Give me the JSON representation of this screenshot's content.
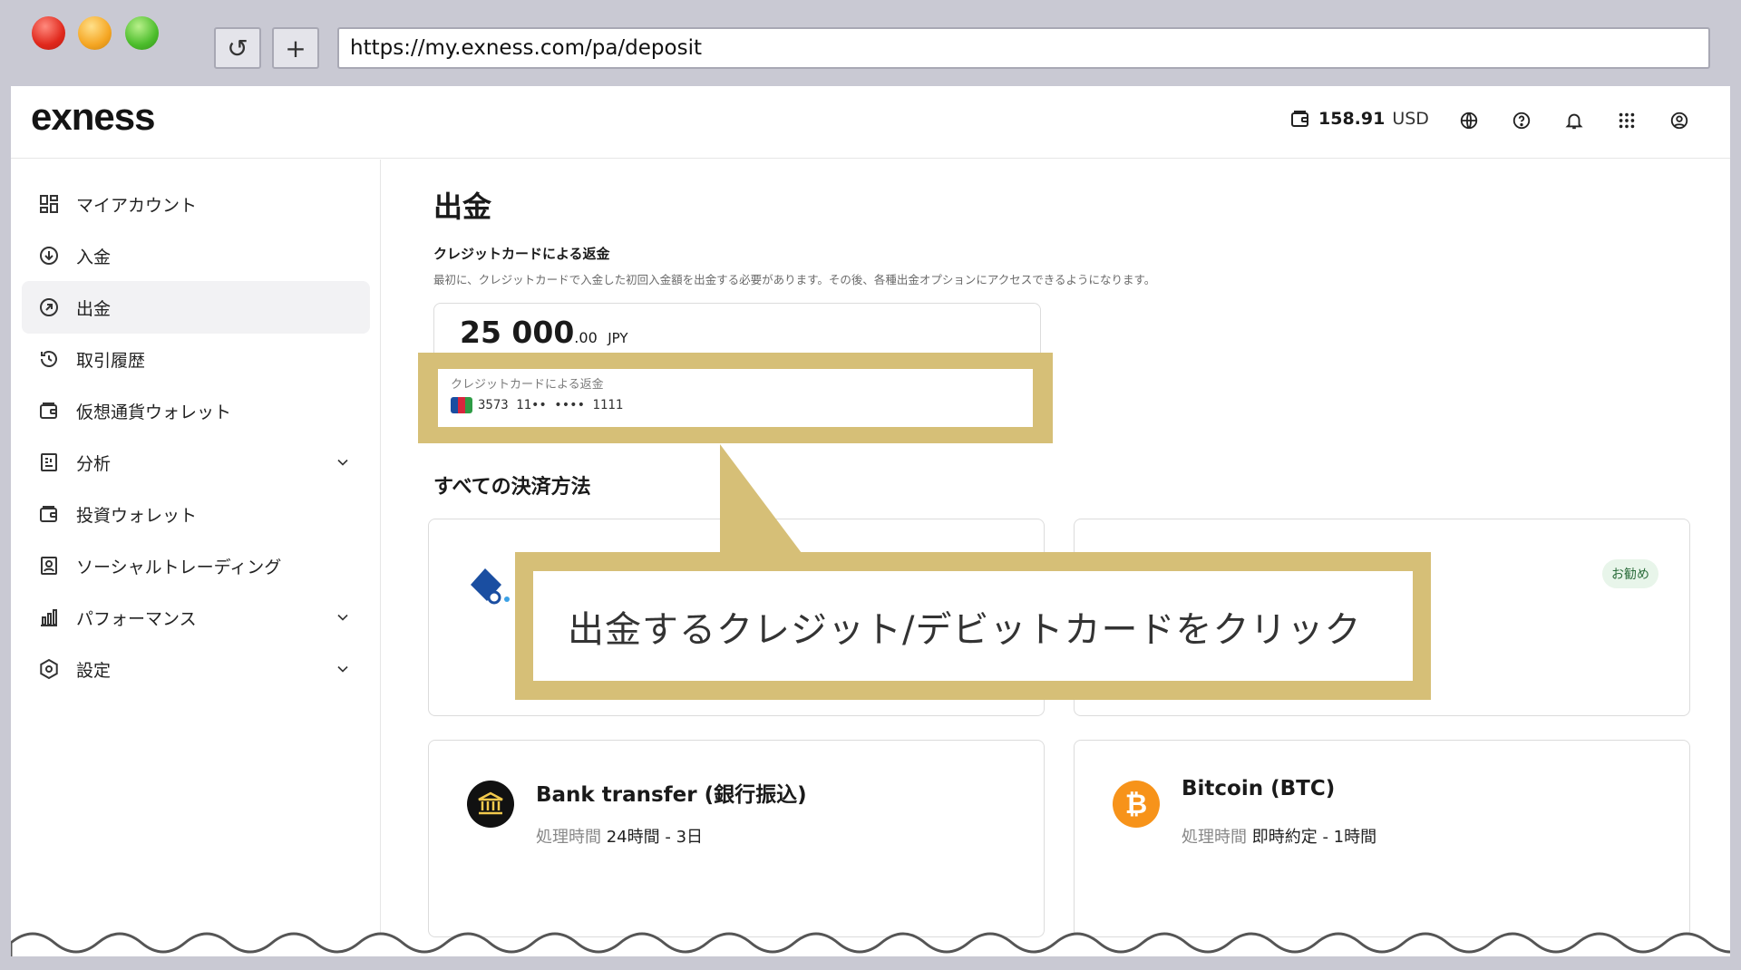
{
  "browser": {
    "url": "https://my.exness.com/pa/deposit",
    "reload_icon": "↺",
    "new_tab_icon": "+"
  },
  "header": {
    "logo": "exness",
    "balance_amount": "158.91",
    "balance_currency": "USD"
  },
  "sidebar": {
    "items": [
      {
        "label": "マイアカウント",
        "icon": "dashboard-icon"
      },
      {
        "label": "入金",
        "icon": "deposit-icon"
      },
      {
        "label": "出金",
        "icon": "withdraw-icon"
      },
      {
        "label": "取引履歴",
        "icon": "history-icon"
      },
      {
        "label": "仮想通貨ウォレット",
        "icon": "wallet-icon"
      },
      {
        "label": "分析",
        "icon": "analytics-icon"
      },
      {
        "label": "投資ウォレット",
        "icon": "wallet-icon"
      },
      {
        "label": "ソーシャルトレーディング",
        "icon": "social-trading-icon"
      },
      {
        "label": "パフォーマンス",
        "icon": "performance-icon"
      },
      {
        "label": "設定",
        "icon": "settings-icon"
      }
    ],
    "collapse_label": "«"
  },
  "main": {
    "title": "出金",
    "refund_title": "クレジットカードによる返金",
    "refund_desc": "最初に、クレジットカードで入金した初回入金額を出金する必要があります。その後、各種出金オプションにアクセスできるようになります。",
    "amount_int": "25 000",
    "amount_dec": ".00",
    "amount_cur": "JPY",
    "card_label": "クレジットカードによる返金",
    "card_number": "3573 11•• •••• 1111",
    "all_methods_title": "すべての決済方法",
    "recommend_badge": "お勧め",
    "methods": [
      {
        "name": "Bank transfer (銀行振込)",
        "time_label": "処理時間",
        "time_value": "24時間 - 3日"
      },
      {
        "name": "Bitcoin (BTC)",
        "time_label": "処理時間",
        "time_value": "即時約定 - 1時間"
      }
    ]
  },
  "callout": {
    "text": "出金するクレジット/デビットカードをクリック"
  },
  "colors": {
    "highlight": "#d6bf77",
    "jcb_blue": "#1a4ea1",
    "jcb_red": "#d7263d",
    "jcb_green": "#2e9b45",
    "bitcoin": "#f7931a"
  }
}
